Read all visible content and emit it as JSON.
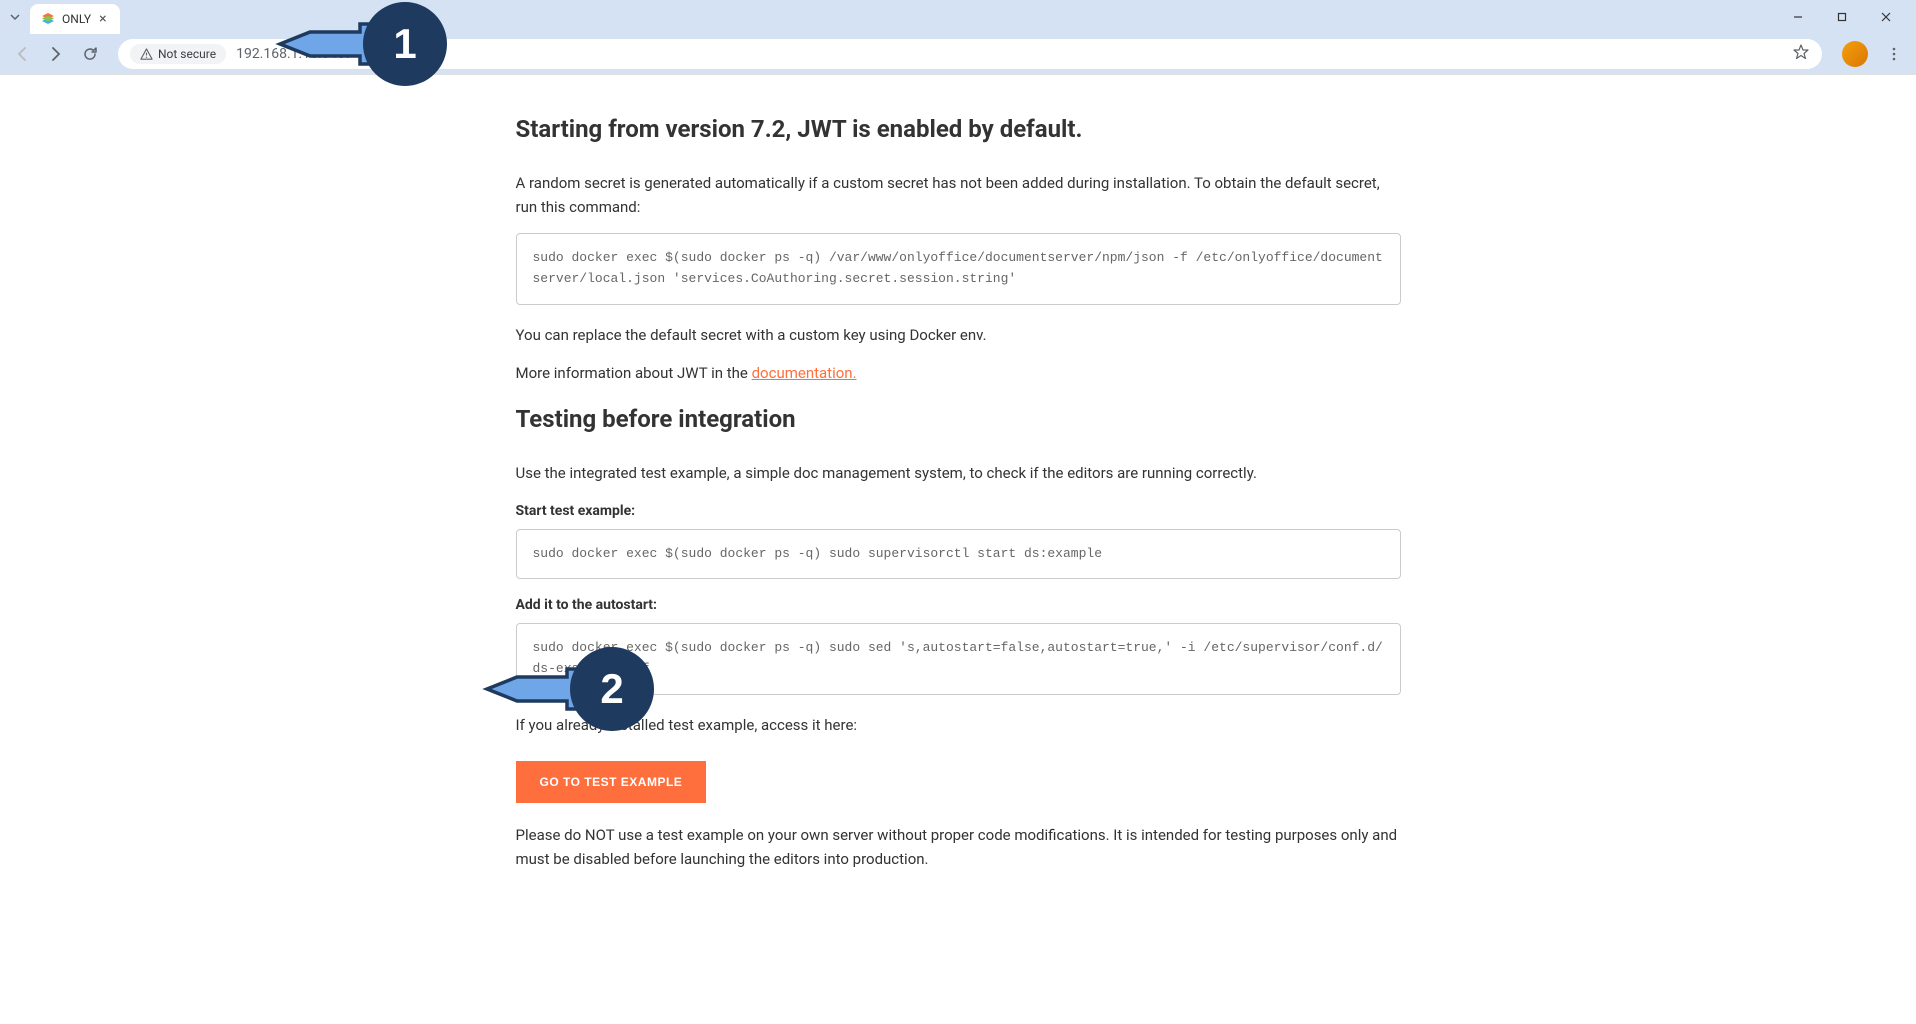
{
  "browser": {
    "tab_title": "ONLY",
    "security_label": "Not secure",
    "url": "192.168.1.18:8467"
  },
  "page": {
    "heading1": "Starting from version 7.2, JWT is enabled by default.",
    "para1": "A random secret is generated automatically if a custom secret has not been added during installation. To obtain the default secret, run this command:",
    "code1": "sudo docker exec $(sudo docker ps -q) /var/www/onlyoffice/documentserver/npm/json -f /etc/onlyoffice/documentserver/local.json 'services.CoAuthoring.secret.session.string'",
    "para2": "You can replace the default secret with a custom key using Docker env.",
    "para3_prefix": "More information about JWT in the ",
    "doc_link": "documentation.",
    "heading2": "Testing before integration",
    "para4": "Use the integrated test example, a simple doc management system, to check if the editors are running correctly.",
    "sub1": "Start test example:",
    "code2": "sudo docker exec $(sudo docker ps -q) sudo supervisorctl start ds:example",
    "sub2": "Add it to the autostart:",
    "code3": "sudo docker exec $(sudo docker ps -q) sudo sed 's,autostart=false,autostart=true,' -i /etc/supervisor/conf.d/ds-example.conf",
    "para5": "If you already installed test example, access it here:",
    "button_label": "GO TO TEST EXAMPLE",
    "para6": "Please do NOT use a test example on your own server without proper code modifications. It is intended for testing purposes only and must be disabled before launching the editors into production."
  },
  "annotations": {
    "badge1": "1",
    "badge2": "2"
  }
}
